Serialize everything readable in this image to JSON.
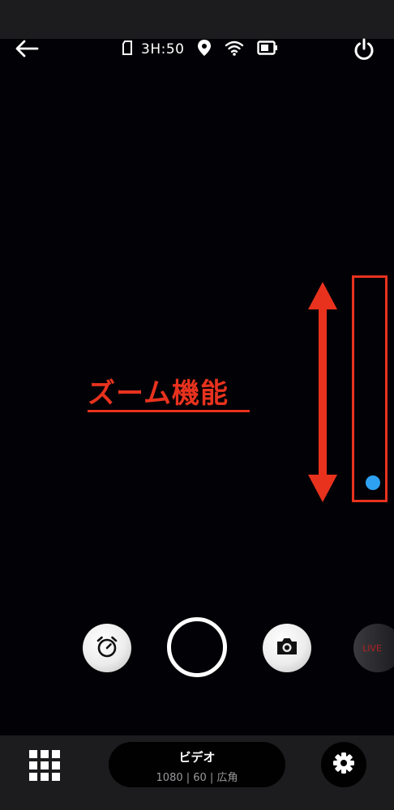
{
  "status": {
    "time_remaining": "3H:50",
    "icons": [
      "sd-card-icon",
      "location-icon",
      "wifi-icon",
      "battery-icon"
    ]
  },
  "annotation": {
    "label": "ズーム機能",
    "color": "#e8321e"
  },
  "zoom": {
    "level": 0,
    "knob_color": "#2ea1f2"
  },
  "controls": {
    "live_label": "LIVE"
  },
  "mode": {
    "title": "ビデオ",
    "details": "1080 | 60 | 広角"
  }
}
